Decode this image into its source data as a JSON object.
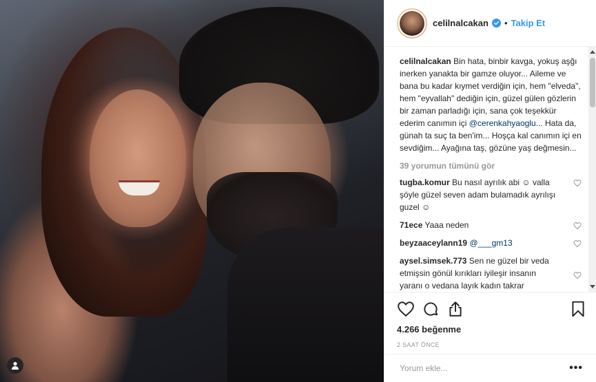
{
  "post": {
    "username": "celilnalcakan",
    "follow_label": "Takip Et",
    "separator": "•",
    "caption": {
      "author": "celilnalcakan",
      "text_before_mention": "Bin hata, binbir kavga, yokuş aşğı inerken yanakta bir gamze oluyor... Aileme ve bana bu kadar kıymet verdiğin için, hem \"elveda\", hem \"eyvallah\" dediğin için, güzel gülen gözlerin bir zaman parladığı için, sana çok teşekkür ederim canımın içi",
      "mention": "@cerenkahyaoglu",
      "text_after_mention": "... Hata da, günah ta suç ta ben'im... Hoşça kal canımın içi en sevdiğim... Ayağına taş, gözüne yaş değmesin..."
    },
    "view_all_comments": "39 yorumun tümünü gör",
    "comments": [
      {
        "user": "tugba.komur",
        "text": "Bu nasıl ayrılık abi ☺ valla şöyle güzel seven adam bulamadık ayrılışı guzel ☺"
      },
      {
        "user": "71ece",
        "text": "Yaaa neden"
      },
      {
        "user": "beyzaaceylann19",
        "mention": "@___gm13",
        "text": ""
      },
      {
        "user": "aysel.simsek.773",
        "text": "Sen ne güzel bir veda etmişsin gönül kırıkları iyileşir insanın yaranı o vedana layık kadın takrar"
      }
    ],
    "likes": "4.266 beğenme",
    "timestamp": "2 SAAT ÖNCE",
    "add_comment_placeholder": "Yorum ekle...",
    "more_label": "•••"
  },
  "icons": {
    "like": "heart-icon",
    "comment": "comment-bubble-icon",
    "share": "share-icon",
    "save": "bookmark-icon",
    "verified": "verified-badge-icon",
    "profile": "user-profile-icon"
  },
  "colors": {
    "link_blue": "#3897f0",
    "mention_blue": "#003569",
    "muted": "#999999",
    "text": "#262626"
  }
}
